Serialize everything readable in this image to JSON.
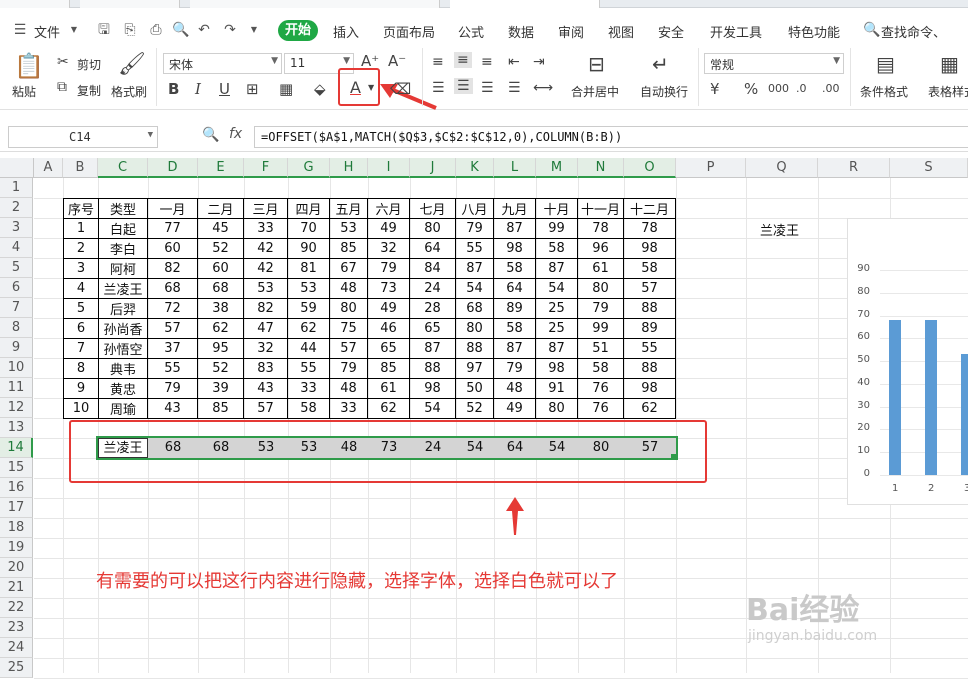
{
  "menu": {
    "file": "文件",
    "start": "开始",
    "items": [
      "插入",
      "页面布局",
      "公式",
      "数据",
      "审阅",
      "视图",
      "安全",
      "开发工具",
      "特色功能"
    ],
    "search": "查找命令、"
  },
  "ribbon": {
    "paste": "粘贴",
    "cut": "剪切",
    "copy": "复制",
    "format_painter": "格式刷",
    "font_name": "宋体",
    "font_size": "11",
    "bold": "B",
    "italic": "I",
    "underline": "U",
    "merge": "合并居中",
    "wrap": "自动换行",
    "number_format": "常规",
    "percent": "%",
    "cond_format": "条件格式",
    "table_style": "表格样式"
  },
  "formula_bar": {
    "cell_ref": "C14",
    "fx": "fx",
    "formula": "=OFFSET($A$1,MATCH($Q$3,$C$2:$C$12,0),COLUMN(B:B))"
  },
  "columns": [
    "A",
    "B",
    "C",
    "D",
    "E",
    "F",
    "G",
    "H",
    "I",
    "J",
    "K",
    "L",
    "M",
    "N",
    "O",
    "P",
    "Q",
    "R",
    "S"
  ],
  "rows": [
    "1",
    "2",
    "3",
    "4",
    "5",
    "6",
    "7",
    "8",
    "9",
    "10",
    "11",
    "12",
    "13",
    "14",
    "15",
    "16",
    "17",
    "18",
    "19",
    "20",
    "21",
    "22",
    "23",
    "24",
    "25"
  ],
  "table": {
    "headers": [
      "序号",
      "类型",
      "一月",
      "二月",
      "三月",
      "四月",
      "五月",
      "六月",
      "七月",
      "八月",
      "九月",
      "十月",
      "十一月",
      "十二月"
    ],
    "rows": [
      [
        "1",
        "白起",
        "77",
        "45",
        "33",
        "70",
        "53",
        "49",
        "80",
        "79",
        "87",
        "99",
        "78",
        "78"
      ],
      [
        "2",
        "李白",
        "60",
        "52",
        "42",
        "90",
        "85",
        "32",
        "64",
        "55",
        "98",
        "58",
        "96",
        "98"
      ],
      [
        "3",
        "阿柯",
        "82",
        "60",
        "42",
        "81",
        "67",
        "79",
        "84",
        "87",
        "58",
        "87",
        "61",
        "58"
      ],
      [
        "4",
        "兰凌王",
        "68",
        "68",
        "53",
        "53",
        "48",
        "73",
        "24",
        "54",
        "64",
        "54",
        "80",
        "57"
      ],
      [
        "5",
        "后羿",
        "72",
        "38",
        "82",
        "59",
        "80",
        "49",
        "28",
        "68",
        "89",
        "25",
        "79",
        "88"
      ],
      [
        "6",
        "孙尚香",
        "57",
        "62",
        "47",
        "62",
        "75",
        "46",
        "65",
        "80",
        "58",
        "25",
        "99",
        "89"
      ],
      [
        "7",
        "孙悟空",
        "37",
        "95",
        "32",
        "44",
        "57",
        "65",
        "87",
        "88",
        "87",
        "87",
        "51",
        "55"
      ],
      [
        "8",
        "典韦",
        "55",
        "52",
        "83",
        "55",
        "79",
        "85",
        "88",
        "97",
        "79",
        "98",
        "58",
        "88"
      ],
      [
        "9",
        "黄忠",
        "79",
        "39",
        "43",
        "33",
        "48",
        "61",
        "98",
        "50",
        "48",
        "91",
        "76",
        "98"
      ],
      [
        "10",
        "周瑜",
        "43",
        "85",
        "57",
        "58",
        "33",
        "62",
        "54",
        "52",
        "49",
        "80",
        "76",
        "62"
      ]
    ]
  },
  "lookup_row": [
    "兰凌王",
    "68",
    "68",
    "53",
    "53",
    "48",
    "73",
    "24",
    "54",
    "64",
    "54",
    "80",
    "57"
  ],
  "q3_value": "兰凌王",
  "annotation": "有需要的可以把这行内容进行隐藏，选择字体，选择白色就可以了",
  "watermark": "Bai经验",
  "watermark_url": "jingyan.baidu.com",
  "chart_data": {
    "type": "bar",
    "categories": [
      "1",
      "2",
      "3"
    ],
    "values": [
      68,
      68,
      53
    ],
    "ylim": [
      0,
      90
    ],
    "yticks": [
      0,
      10,
      20,
      30,
      40,
      50,
      60,
      70,
      80,
      90
    ],
    "color": "#5b9bd5"
  }
}
